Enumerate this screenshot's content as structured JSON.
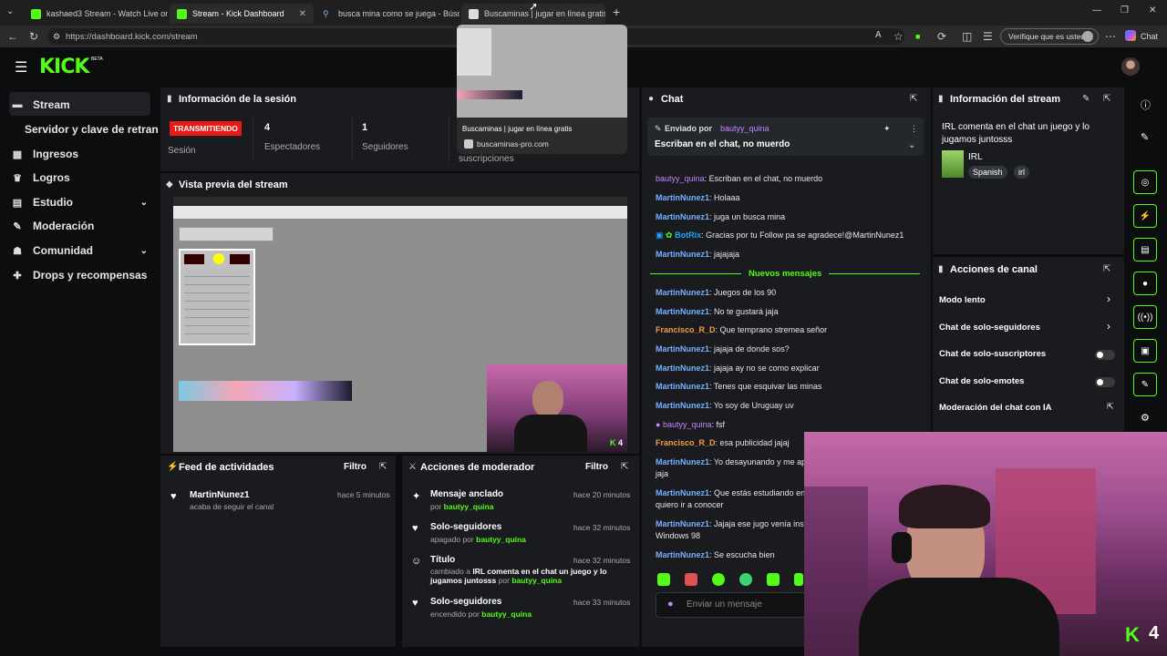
{
  "browser": {
    "tabs": [
      {
        "title": "kashaed3 Stream - Watch Live on"
      },
      {
        "title": "Stream - Kick Dashboard"
      },
      {
        "title": "busca mina como se juega - Búsq"
      },
      {
        "title": "Buscaminas | jugar en línea gratis"
      }
    ],
    "url": "https://dashboard.kick.com/stream",
    "verify_label": "Verifique que es usted",
    "chat_label": "Chat"
  },
  "tab_preview": {
    "title": "Buscaminas | jugar en línea gratis",
    "domain": "buscaminas-pro.com"
  },
  "kick": {
    "logo": "KICK",
    "beta": "BETA"
  },
  "sidebar": {
    "items": [
      {
        "label": "Stream",
        "icon": "stream-icon"
      },
      {
        "label": "Servidor y clave de retransmisión",
        "icon": ""
      },
      {
        "label": "Ingresos",
        "icon": "money-icon"
      },
      {
        "label": "Logros",
        "icon": "trophy-icon"
      },
      {
        "label": "Estudio",
        "icon": "studio-icon"
      },
      {
        "label": "Moderación",
        "icon": "wrench-icon"
      },
      {
        "label": "Comunidad",
        "icon": "people-icon"
      },
      {
        "label": "Drops y recompensas",
        "icon": "gift-icon"
      }
    ]
  },
  "session": {
    "title": "Información de la sesión",
    "status": "TRANSMITIENDO",
    "status_label": "Sesión",
    "viewers": "4",
    "viewers_label": "Espectadores",
    "followers": "1",
    "followers_label": "Seguidores",
    "subs_label": "suscripciones"
  },
  "preview": {
    "title": "Vista previa del stream"
  },
  "chat": {
    "title": "Chat",
    "pinned_by_label": "Enviado por",
    "pinned_user": "bautyy_quina",
    "pinned_text": "Escriban en el chat, no muerdo",
    "new_messages": "Nuevos mensajes",
    "input_placeholder": "Enviar un mensaje",
    "messages": [
      {
        "user": "bautyy_quina",
        "text": "Escriban en el chat, no muerdo"
      },
      {
        "user": "MartinNunez1",
        "text": "Holaaa"
      },
      {
        "user": "MartinNunez1",
        "text": "juga un busca mina"
      },
      {
        "user": "BotRix",
        "text": "Gracias por tu Follow pa se agradece!@MartinNunez1"
      },
      {
        "user": "MartinNunez1",
        "text": "jajajaja"
      },
      {
        "user": "MartinNunez1",
        "text": "Juegos de los 90"
      },
      {
        "user": "MartinNunez1",
        "text": "No te gustará jaja"
      },
      {
        "user": "Francisco_R_D",
        "text": "Que temprano stremea señor"
      },
      {
        "user": "MartinNunez1",
        "text": "jajaja de donde sos?"
      },
      {
        "user": "MartinNunez1",
        "text": "jajaja ay no se como explicar"
      },
      {
        "user": "MartinNunez1",
        "text": "Tenes que esquivar las minas"
      },
      {
        "user": "MartinNunez1",
        "text": "Yo soy de Uruguay uv"
      },
      {
        "user": "bautyy_quina",
        "text": "fsf"
      },
      {
        "user": "Francisco_R_D",
        "text": "esa publicidad jajaj"
      },
      {
        "user": "MartinNunez1",
        "text": "Yo desayunando y me ap"
      },
      {
        "user": "",
        "text": "jaja"
      },
      {
        "user": "MartinNunez1",
        "text": "Que estás estudiando en"
      },
      {
        "user": "",
        "text": "quiero ir a conocer"
      },
      {
        "user": "MartinNunez1",
        "text": "Jajaja ese jugo venía ins"
      },
      {
        "user": "",
        "text": "Windows 98"
      },
      {
        "user": "MartinNunez1",
        "text": "Se escucha bien"
      }
    ]
  },
  "stream_info": {
    "title": "Información del stream",
    "stream_title": "IRL comenta en el chat un juego y lo jugamos juntosss",
    "category": "IRL",
    "tags": [
      "Spanish",
      "irl"
    ]
  },
  "channel_actions": {
    "title": "Acciones de canal",
    "items": [
      {
        "label": "Modo lento",
        "control": "chevron"
      },
      {
        "label": "Chat de solo-seguidores",
        "control": "chevron"
      },
      {
        "label": "Chat de solo-suscriptores",
        "control": "toggle"
      },
      {
        "label": "Chat de solo-emotes",
        "control": "toggle"
      },
      {
        "label": "Moderación del chat con IA",
        "control": "external"
      }
    ]
  },
  "activity": {
    "title": "Feed de actividades",
    "filter_label": "Filtro",
    "items": [
      {
        "user": "MartinNunez1",
        "text": "acaba de seguir el canal",
        "time": "hace 5 minutos"
      }
    ]
  },
  "mod_actions": {
    "title": "Acciones de moderador",
    "filter_label": "Filtro",
    "items": [
      {
        "title": "Mensaje anclado",
        "sub_prefix": "por",
        "user": "bautyy_quina",
        "time": "hace 20 minutos",
        "icon": "pin-icon"
      },
      {
        "title": "Solo-seguidores",
        "sub_prefix": "apagado por",
        "user": "bautyy_quina",
        "time": "hace 32 minutos",
        "icon": "heart-icon"
      },
      {
        "title": "Título",
        "sub_prefix": "cambiado a",
        "detail": "IRL comenta en el chat un juego y lo jugamos juntosss",
        "sub_suffix": "por",
        "user": "bautyy_quina",
        "time": "hace 32 minutos",
        "icon": "user-edit-icon"
      },
      {
        "title": "Solo-seguidores",
        "sub_prefix": "encendido por",
        "user": "bautyy_quina",
        "time": "hace 33 minutos",
        "icon": "heart-icon"
      }
    ]
  },
  "webcam_badge": "4",
  "preview_badge": "4",
  "colors": {
    "accent": "#53fc18",
    "live": "#e91916",
    "panel": "#191b1f",
    "bg": "#0b0d0f"
  }
}
